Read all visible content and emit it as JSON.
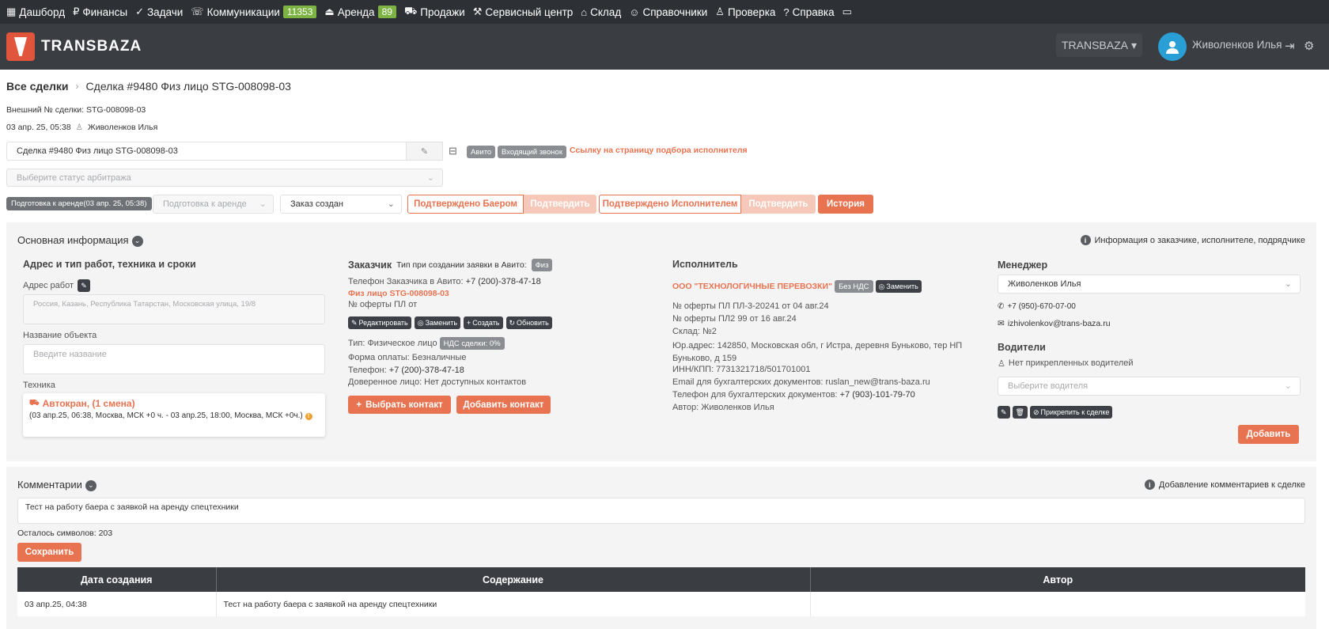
{
  "nav": {
    "items": [
      {
        "icon": "dashboard-icon",
        "glyph": "▦",
        "label": "Дашборд"
      },
      {
        "icon": "ruble-icon",
        "glyph": "₽",
        "label": "Финансы"
      },
      {
        "icon": "check-circle-icon",
        "glyph": "✓",
        "label": "Задачи"
      },
      {
        "icon": "phone-icon",
        "glyph": "☏",
        "label": "Коммуникации",
        "badge": "11353"
      },
      {
        "icon": "rent-icon",
        "glyph": "⏏",
        "label": "Аренда",
        "badge": "89"
      },
      {
        "icon": "cart-icon",
        "glyph": "⛟",
        "label": "Продажи"
      },
      {
        "icon": "tools-icon",
        "glyph": "⚒",
        "label": "Сервисный центр"
      },
      {
        "icon": "warehouse-icon",
        "glyph": "⌂",
        "label": "Склад"
      },
      {
        "icon": "users-icon",
        "glyph": "☺",
        "label": "Справочники"
      },
      {
        "icon": "user-check-icon",
        "glyph": "♙",
        "label": "Проверка"
      },
      {
        "icon": "help-icon",
        "glyph": "?",
        "label": "Справка"
      },
      {
        "icon": "chat-icon",
        "glyph": "▭",
        "label": ""
      }
    ]
  },
  "header": {
    "logo": "TRANSBAZA",
    "company_select": "TRANSBAZA",
    "user_name": "Живоленков Илья"
  },
  "breadcrumb": {
    "root": "Все сделки",
    "current": "Сделка #9480 Физ лицо STG-008098-03"
  },
  "deal": {
    "external_no": "Внешний № сделки: STG-008098-03",
    "created": "03 апр. 25, 05:38",
    "author": "Живоленков Илья",
    "name_value": "Сделка #9480 Физ лицо STG-008098-03",
    "tag_avito": "Авито",
    "tag_call": "Входящий звонок",
    "link_executor": "Ссылку на страницу подбора исполнителя",
    "arbitration_placeholder": "Выберите статус арбитража",
    "status_badge": "Подготовка к аренде(03 апр. 25, 05:38)",
    "stage_select": "Подготовка к аренде",
    "order_select": "Заказ создан",
    "btn_confirmed_buyer": "Подтверждено Баером",
    "btn_confirm1": "Подтвердить",
    "btn_confirmed_executor": "Подтверждено Исполнителем",
    "btn_confirm2": "Подтвердить",
    "btn_history": "История"
  },
  "main_info": {
    "title": "Основная информация",
    "info_note": "Информация о заказчике, исполнителе, подрядчике",
    "address": {
      "title": "Адрес и тип работ, техника и сроки",
      "address_label": "Адрес работ",
      "address_placeholder": "Россия, Казань, Республика Татарстан, Московская улица, 19/8",
      "object_label": "Название объекта",
      "object_placeholder": "Введите название",
      "tech_label": "Техника",
      "tech_name": "Автокран, (1 смена)",
      "tech_details": "(03 апр.25, 06:38, Москва, МСК +0 ч. - 03 апр.25, 18:00, Москва, МСК +0ч.)"
    },
    "customer": {
      "title": "Заказчик",
      "avito_type_label": "Тип при создании заявки в Авито:",
      "avito_type": "Физ",
      "phone_avito_label": "Телефон Заказчика в Авито:",
      "phone_avito": "+7 (200)-378-47-18",
      "client_link": "Физ лицо STG-008098-03",
      "offer_label": "№ оферты ПЛ от",
      "btn_edit": "Редактировать",
      "btn_replace": "Заменить",
      "btn_create": "Создать",
      "btn_refresh": "Обновить",
      "type_label": "Тип: Физическое лицо",
      "vat_tag": "НДС сделки: 0%",
      "payment_form": "Форма оплаты: Безналичные",
      "phone_label": "Телефон:",
      "phone": "+7 (200)-378-47-18",
      "trusted": "Доверенное лицо: Нет доступных контактов",
      "btn_choose_contact": "Выбрать контакт",
      "btn_add_contact": "Добавить контакт"
    },
    "executor": {
      "title": "Исполнитель",
      "company": "ООО \"ТЕХНОЛОГИЧНЫЕ ПЕРЕВОЗКИ\"",
      "vat_tag": "Без НДС",
      "btn_replace": "Заменить",
      "offer1": "№ оферты ПЛ ПЛ-3-20241 от 04 авг.24",
      "offer2": "№ оферты ПЛ2 99 от 16 авг.24",
      "warehouse": "Склад: №2",
      "address": "Юр.адрес: 142850, Московская обл, г Истра, деревня Буньково, тер НП Буньково, д 159",
      "inn": "ИНН/КПП: 7731321718/501701001",
      "email_label": "Email для бухгалтерских документов: ruslan_new@trans-baza.ru",
      "phone_label": "Телефон для бухгалтерских документов:",
      "phone": "+7 (903)-101-79-70",
      "author": "Автор: Живоленков Илья"
    },
    "manager": {
      "title": "Менеджер",
      "selected": "Живоленков Илья",
      "phone": "+7 (950)-670-07-00",
      "email": "izhivolenkov@trans-baza.ru",
      "drivers_title": "Водители",
      "no_drivers": "Нет прикрепленных водителей",
      "driver_placeholder": "Выберите водителя",
      "btn_attach": "Прикрепить к сделке",
      "btn_add": "Добавить"
    }
  },
  "comments": {
    "title": "Комментарии",
    "info_note": "Добавление комментариев к сделке",
    "text": "Тест на работу баера с заявкой на аренду спецтехники",
    "remaining": "Осталось символов: 203",
    "btn_save": "Сохранить",
    "columns": [
      "Дата создания",
      "Содержание",
      "Автор"
    ],
    "rows": [
      {
        "date": "03 апр.25, 04:38",
        "content": "Тест на работу баера с заявкой на аренду спецтехники",
        "author": ""
      }
    ]
  },
  "colors": {
    "accent": "#e87350",
    "nav_bg": "#2d3035",
    "header_bg": "#3a3e43",
    "badge_green": "#7cb342"
  }
}
